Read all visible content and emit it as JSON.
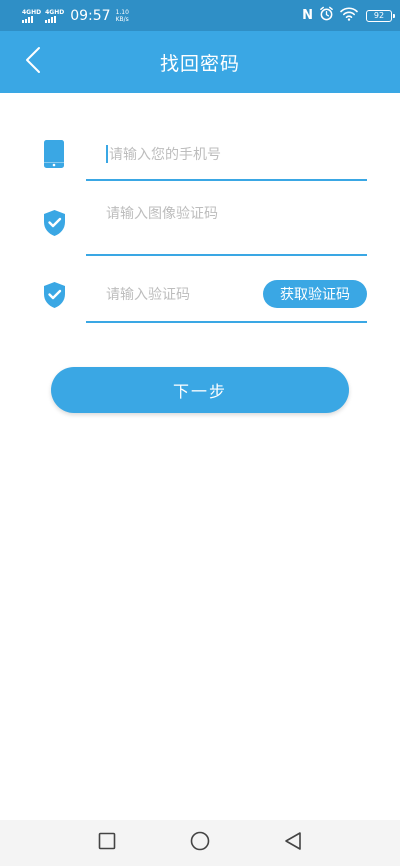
{
  "status_bar": {
    "signal1_label": "4GHD",
    "signal2_label": "4GHD",
    "time": "09:57",
    "net_speed_value": "1.10",
    "net_speed_unit": "KB/s",
    "nfc": "N",
    "battery": "92"
  },
  "header": {
    "title": "找回密码"
  },
  "form": {
    "phone_placeholder": "请输入您的手机号",
    "image_code_placeholder": "请输入图像验证码",
    "sms_code_placeholder": "请输入验证码",
    "get_code_label": "获取验证码"
  },
  "actions": {
    "next_label": "下一步"
  },
  "colors": {
    "primary": "#3aa7e4",
    "status_bar": "#2f8fc6",
    "placeholder": "#bdbdbd"
  }
}
